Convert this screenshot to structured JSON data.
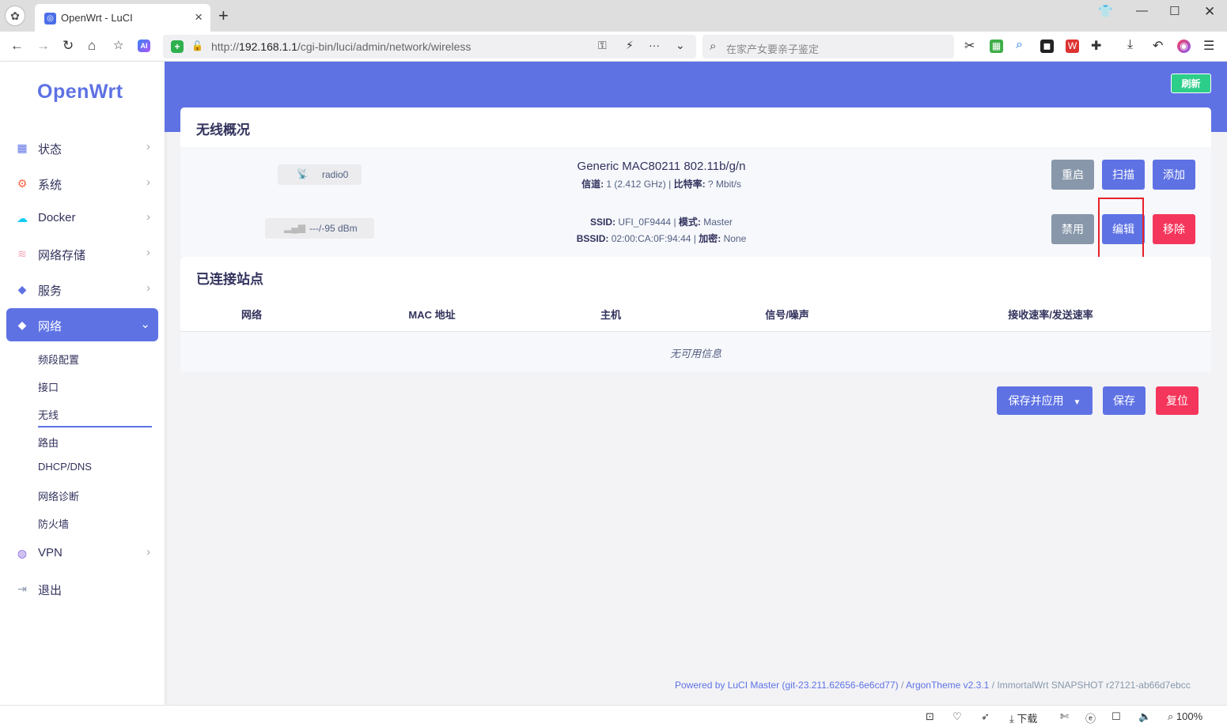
{
  "browser": {
    "tab_title": "OpenWrt - LuCI",
    "url_scheme": "http://",
    "url_host": "192.168.1.1",
    "url_path": "/cgi-bin/luci/admin/network/wireless",
    "search_placeholder": "在家产女要亲子鉴定",
    "zoom": "100%",
    "download_label": "下载"
  },
  "sidebar": {
    "brand": "OpenWrt",
    "items": [
      {
        "label": "状态",
        "icon": "grid-icon"
      },
      {
        "label": "系统",
        "icon": "gear-icon"
      },
      {
        "label": "Docker",
        "icon": "docker-icon"
      },
      {
        "label": "网络存储",
        "icon": "storage-icon"
      },
      {
        "label": "服务",
        "icon": "cube-icon"
      },
      {
        "label": "网络",
        "icon": "cube-icon"
      },
      {
        "label": "VPN",
        "icon": "globe-icon"
      },
      {
        "label": "退出",
        "icon": "logout-icon"
      }
    ],
    "network_sub": [
      "频段配置",
      "接口",
      "无线",
      "路由",
      "DHCP/DNS",
      "网络诊断",
      "防火墙"
    ]
  },
  "header": {
    "refresh_label": "刷新"
  },
  "wireless_overview": {
    "title": "无线概况",
    "radio": {
      "badge": "radio0",
      "name": "Generic MAC80211 802.11b/g/n",
      "channel_label": "信道:",
      "channel_value": "1 (2.412 GHz)",
      "bitrate_label": "比特率:",
      "bitrate_value": "? Mbit/s",
      "buttons": {
        "restart": "重启",
        "scan": "扫描",
        "add": "添加"
      }
    },
    "network": {
      "badge": "---/-95 dBm",
      "ssid_label": "SSID:",
      "ssid_value": "UFI_0F9444",
      "mode_label": "模式:",
      "mode_value": "Master",
      "bssid_label": "BSSID:",
      "bssid_value": "02:00:CA:0F:94:44",
      "enc_label": "加密:",
      "enc_value": "None",
      "buttons": {
        "disable": "禁用",
        "edit": "编辑",
        "remove": "移除"
      }
    }
  },
  "stations": {
    "title": "已连接站点",
    "columns": [
      "网络",
      "MAC 地址",
      "主机",
      "信号/噪声",
      "接收速率/发送速率"
    ],
    "empty": "无可用信息"
  },
  "actions": {
    "save_apply": "保存并应用",
    "save": "保存",
    "reset": "复位"
  },
  "footer": {
    "luci": "Powered by LuCI Master (git-23.211.62656-6e6cd77)",
    "sep1": " / ",
    "theme": "ArgonTheme v2.3.1",
    "sep2": " / ",
    "build": "ImmortalWrt SNAPSHOT r27121-ab66d7ebcc"
  },
  "colors": {
    "primary": "#5e72e4",
    "success": "#2dce89",
    "danger": "#f5365c",
    "muted": "#8898aa"
  }
}
